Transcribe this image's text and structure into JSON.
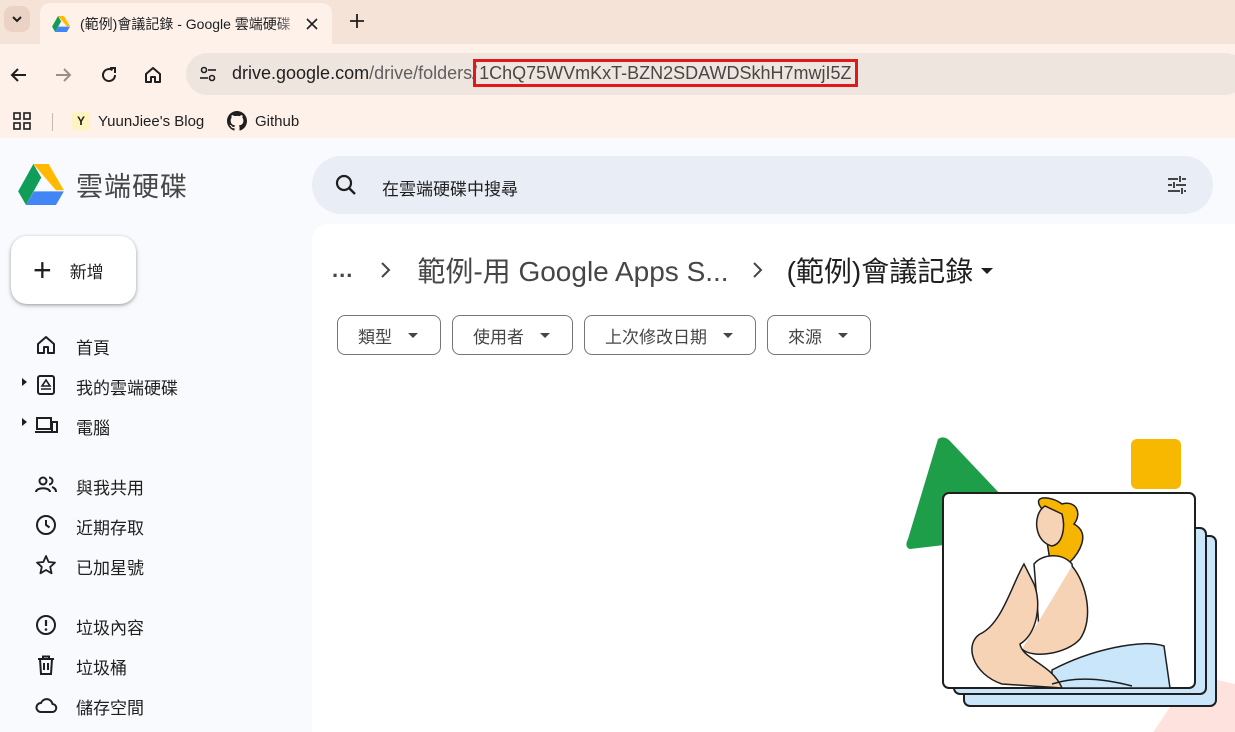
{
  "browser": {
    "tab_title": "(範例)會議記錄 - Google 雲端硬碟",
    "url_host": "drive.google.com",
    "url_path": "/drive/folders/",
    "url_folder_id": "1ChQ75WVmKxT-BZN2SDAWDSkhH7mwjI5Z",
    "bookmarks": [
      {
        "label": "YuunJiee's Blog",
        "favicon_letter": "Y"
      },
      {
        "label": "Github"
      }
    ]
  },
  "drive": {
    "brand": "雲端硬碟",
    "search_placeholder": "在雲端硬碟中搜尋",
    "new_label": "新增",
    "nav": [
      {
        "label": "首頁",
        "icon": "home-icon"
      },
      {
        "label": "我的雲端硬碟",
        "icon": "my-drive-icon"
      },
      {
        "label": "電腦",
        "icon": "computers-icon"
      },
      {
        "label": "與我共用",
        "icon": "shared-icon"
      },
      {
        "label": "近期存取",
        "icon": "recent-icon"
      },
      {
        "label": "已加星號",
        "icon": "star-icon"
      },
      {
        "label": "垃圾內容",
        "icon": "spam-icon"
      },
      {
        "label": "垃圾桶",
        "icon": "trash-icon"
      },
      {
        "label": "儲存空間",
        "icon": "cloud-icon"
      }
    ],
    "breadcrumb": {
      "more": "...",
      "parent": "範例-用 Google Apps S...",
      "current": "(範例)會議記錄"
    },
    "filters": [
      "類型",
      "使用者",
      "上次修改日期",
      "來源"
    ]
  }
}
